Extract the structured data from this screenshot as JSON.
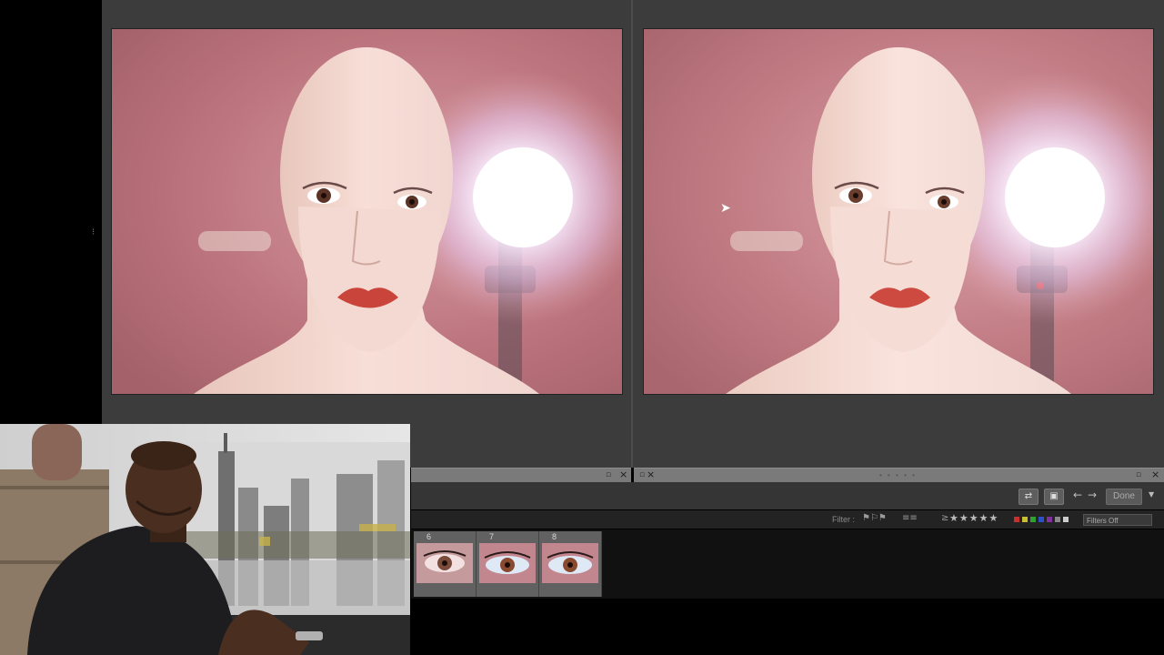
{
  "compare": {
    "left_handle_icon": "drag-handle-icon",
    "cursor_icon": "mouse-pointer-icon"
  },
  "pane_bars": {
    "close_glyph": "×",
    "flag_glyph": "▫",
    "dots": "• • • • •"
  },
  "toolbar": {
    "done_label": "Done",
    "prev_arrow": "←",
    "next_arrow": "→",
    "menu_arrow": "▼"
  },
  "filter_bar": {
    "label": "Filter :",
    "rating_op": "≥",
    "stars": "★★★★★",
    "filters_select": "Filters Off",
    "color_labels": [
      "#c83030",
      "#c8c030",
      "#30a030",
      "#3050c8",
      "#8030a0",
      "#888888",
      "#cccccc"
    ]
  },
  "filmstrip": {
    "thumbnails": [
      {
        "number": "6"
      },
      {
        "number": "7"
      },
      {
        "number": "8"
      }
    ]
  }
}
